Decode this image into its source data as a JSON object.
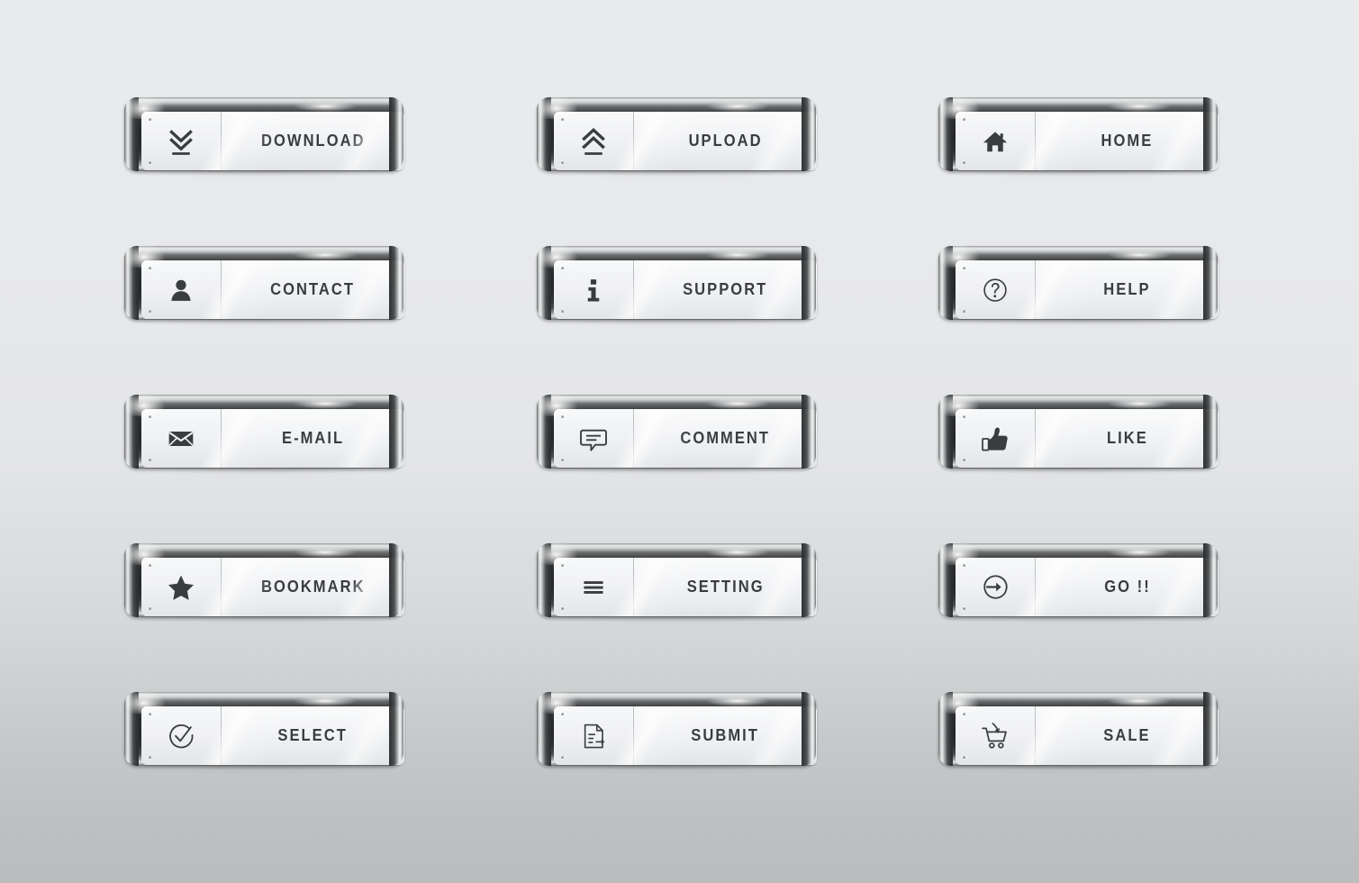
{
  "page": {
    "title": "Metallic Chrome Web Button Set",
    "background_top_color": "#e9eaec",
    "background_bottom_color": "#babcbe",
    "label_color": "#3a3c3e",
    "bezel_dark_color": "#252729",
    "bezel_light_color": "#f2f4f4",
    "plate_color": "#f4f5f6",
    "columns": 3,
    "rows": 5,
    "button_count": 15
  },
  "buttons": [
    {
      "id": "download",
      "label": "DOWNLOAD",
      "icon": "double-chevron-down-line-icon",
      "row": 1,
      "col": 1
    },
    {
      "id": "upload",
      "label": "UPLOAD",
      "icon": "double-chevron-up-line-icon",
      "row": 1,
      "col": 2
    },
    {
      "id": "home",
      "label": "HOME",
      "icon": "house-icon",
      "row": 1,
      "col": 3
    },
    {
      "id": "contact",
      "label": "CONTACT",
      "icon": "person-icon",
      "row": 2,
      "col": 1
    },
    {
      "id": "support",
      "label": "SUPPORT",
      "icon": "info-letter-i-icon",
      "row": 2,
      "col": 2
    },
    {
      "id": "help",
      "label": "HELP",
      "icon": "question-mark-circle-icon",
      "row": 2,
      "col": 3
    },
    {
      "id": "email",
      "label": "E-MAIL",
      "icon": "envelope-icon",
      "row": 3,
      "col": 1
    },
    {
      "id": "comment",
      "label": "COMMENT",
      "icon": "speech-bubble-lines-icon",
      "row": 3,
      "col": 2
    },
    {
      "id": "like",
      "label": "LIKE",
      "icon": "thumbs-up-icon",
      "row": 3,
      "col": 3
    },
    {
      "id": "bookmark",
      "label": "BOOKMARK",
      "icon": "star-icon",
      "row": 4,
      "col": 1
    },
    {
      "id": "setting",
      "label": "SETTING",
      "icon": "hamburger-menu-icon",
      "row": 4,
      "col": 2
    },
    {
      "id": "go",
      "label": "GO !!",
      "icon": "arrow-into-circle-icon",
      "row": 4,
      "col": 3
    },
    {
      "id": "select",
      "label": "SELECT",
      "icon": "check-circle-icon",
      "row": 5,
      "col": 1
    },
    {
      "id": "submit",
      "label": "SUBMIT",
      "icon": "document-arrow-icon",
      "row": 5,
      "col": 2
    },
    {
      "id": "sale",
      "label": "SALE",
      "icon": "shopping-cart-arrow-icon",
      "row": 5,
      "col": 3
    }
  ]
}
